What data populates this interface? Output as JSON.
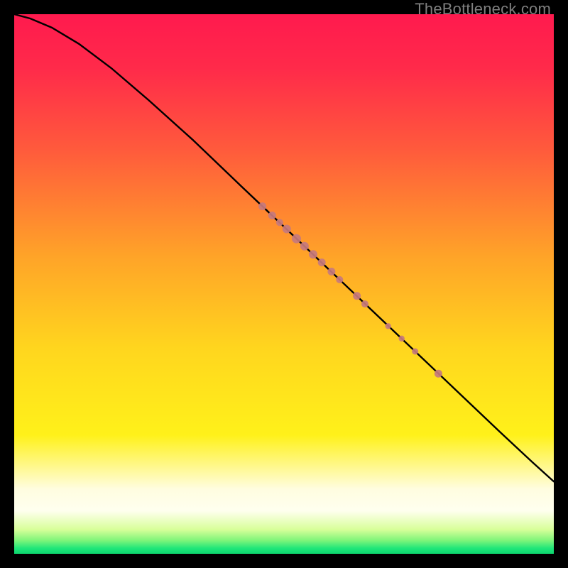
{
  "watermark": "TheBottleneck.com",
  "chart_data": {
    "type": "line",
    "title": "",
    "xlabel": "",
    "ylabel": "",
    "xlim": [
      0,
      100
    ],
    "ylim": [
      0,
      100
    ],
    "background_gradient_stops": [
      {
        "pos": 0.0,
        "color": "#ff1a4e"
      },
      {
        "pos": 0.1,
        "color": "#ff2a4a"
      },
      {
        "pos": 0.25,
        "color": "#ff5a3c"
      },
      {
        "pos": 0.45,
        "color": "#ffa428"
      },
      {
        "pos": 0.62,
        "color": "#ffd61e"
      },
      {
        "pos": 0.78,
        "color": "#fff11a"
      },
      {
        "pos": 0.88,
        "color": "#fffde0"
      },
      {
        "pos": 0.92,
        "color": "#ffffef"
      },
      {
        "pos": 0.955,
        "color": "#d8ff99"
      },
      {
        "pos": 0.975,
        "color": "#7ff57a"
      },
      {
        "pos": 0.99,
        "color": "#1fe679"
      },
      {
        "pos": 1.0,
        "color": "#0cd66e"
      }
    ],
    "series": [
      {
        "name": "curve",
        "x": [
          0,
          3,
          7,
          12,
          18,
          25,
          33,
          42,
          50,
          58,
          66,
          74,
          82,
          90,
          96,
          100
        ],
        "y": [
          100,
          99.2,
          97.5,
          94.5,
          90.0,
          84.0,
          76.8,
          68.2,
          60.6,
          53.0,
          45.4,
          37.8,
          30.2,
          22.6,
          17.0,
          13.4
        ]
      }
    ],
    "points": [
      {
        "x": 46.0,
        "y": 64.4,
        "r": 5.5
      },
      {
        "x": 47.8,
        "y": 62.7,
        "r": 5.5
      },
      {
        "x": 49.2,
        "y": 61.4,
        "r": 5.0
      },
      {
        "x": 50.5,
        "y": 60.2,
        "r": 6.0
      },
      {
        "x": 52.3,
        "y": 58.4,
        "r": 6.5
      },
      {
        "x": 53.8,
        "y": 57.0,
        "r": 6.0
      },
      {
        "x": 55.4,
        "y": 55.5,
        "r": 6.0
      },
      {
        "x": 57.0,
        "y": 54.0,
        "r": 5.5
      },
      {
        "x": 58.8,
        "y": 52.3,
        "r": 5.5
      },
      {
        "x": 60.3,
        "y": 50.8,
        "r": 5.0
      },
      {
        "x": 63.5,
        "y": 47.8,
        "r": 5.5
      },
      {
        "x": 65.0,
        "y": 46.3,
        "r": 5.0
      },
      {
        "x": 69.3,
        "y": 42.2,
        "r": 4.2
      },
      {
        "x": 71.8,
        "y": 39.9,
        "r": 4.2
      },
      {
        "x": 74.3,
        "y": 37.5,
        "r": 4.5
      },
      {
        "x": 78.6,
        "y": 33.4,
        "r": 5.5
      }
    ]
  }
}
